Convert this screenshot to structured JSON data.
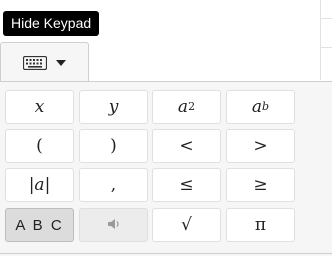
{
  "tooltip": {
    "text": "Hide Keypad"
  },
  "tab": {
    "icon": "keyboard-icon",
    "caret_icon": "caret-down-icon"
  },
  "keys": {
    "x": "x",
    "y": "y",
    "a_squared_base": "a",
    "a_squared_exp": "2",
    "a_power_b_base": "a",
    "a_power_b_exp": "b",
    "left_paren": "(",
    "right_paren": ")",
    "less_than": "<",
    "greater_than": ">",
    "abs_value": "|a|",
    "comma": ",",
    "less_equal": "≤",
    "greater_equal": "≥",
    "abc": "A B C",
    "sound_icon": "speaker-icon",
    "sqrt": "√",
    "pi": "π"
  }
}
